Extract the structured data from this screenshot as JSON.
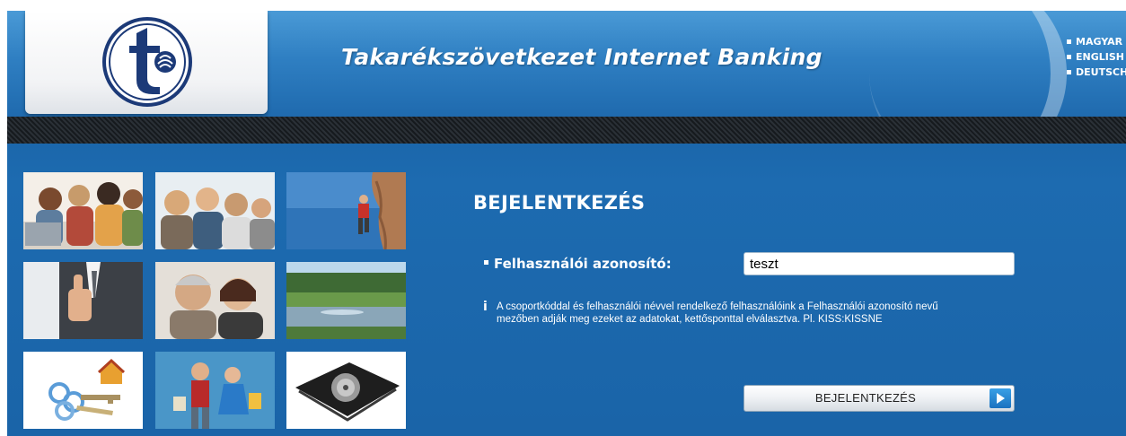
{
  "header": {
    "title": "Takarékszövetkezet Internet Banking",
    "logo": "takarekszovetkezet-logo",
    "languages": [
      {
        "label": "MAGYAR"
      },
      {
        "label": "ENGLISH"
      },
      {
        "label": "DEUTSCH"
      }
    ]
  },
  "gallery": {
    "images": [
      "students-laptop-photo",
      "young-people-photo",
      "rock-climber-photo",
      "thumbs-up-businessman-photo",
      "senior-couple-phone-photo",
      "lake-landscape-photo",
      "keys-house-photo",
      "couple-shopping-photo",
      "wallet-safe-photo"
    ]
  },
  "login": {
    "title": "BEJELENTKEZÉS",
    "field_label": "Felhasználói azonosító:",
    "field_value": "teszt",
    "info_icon": "i",
    "info_text": "A csoportkóddal és felhasználói névvel rendelkező felhasználóink a Felhasználói azonosító nevű mezőben adják meg ezeket az adatokat, kettősponttal elválasztva. Pl. KISS:KISSNE",
    "button_label": "BEJELENTKEZÉS"
  },
  "colors": {
    "brand_blue": "#1a64a8",
    "header_blue": "#2f7fc2",
    "logo_navy": "#1c3a78",
    "stripe_dark": "#1e2328"
  }
}
